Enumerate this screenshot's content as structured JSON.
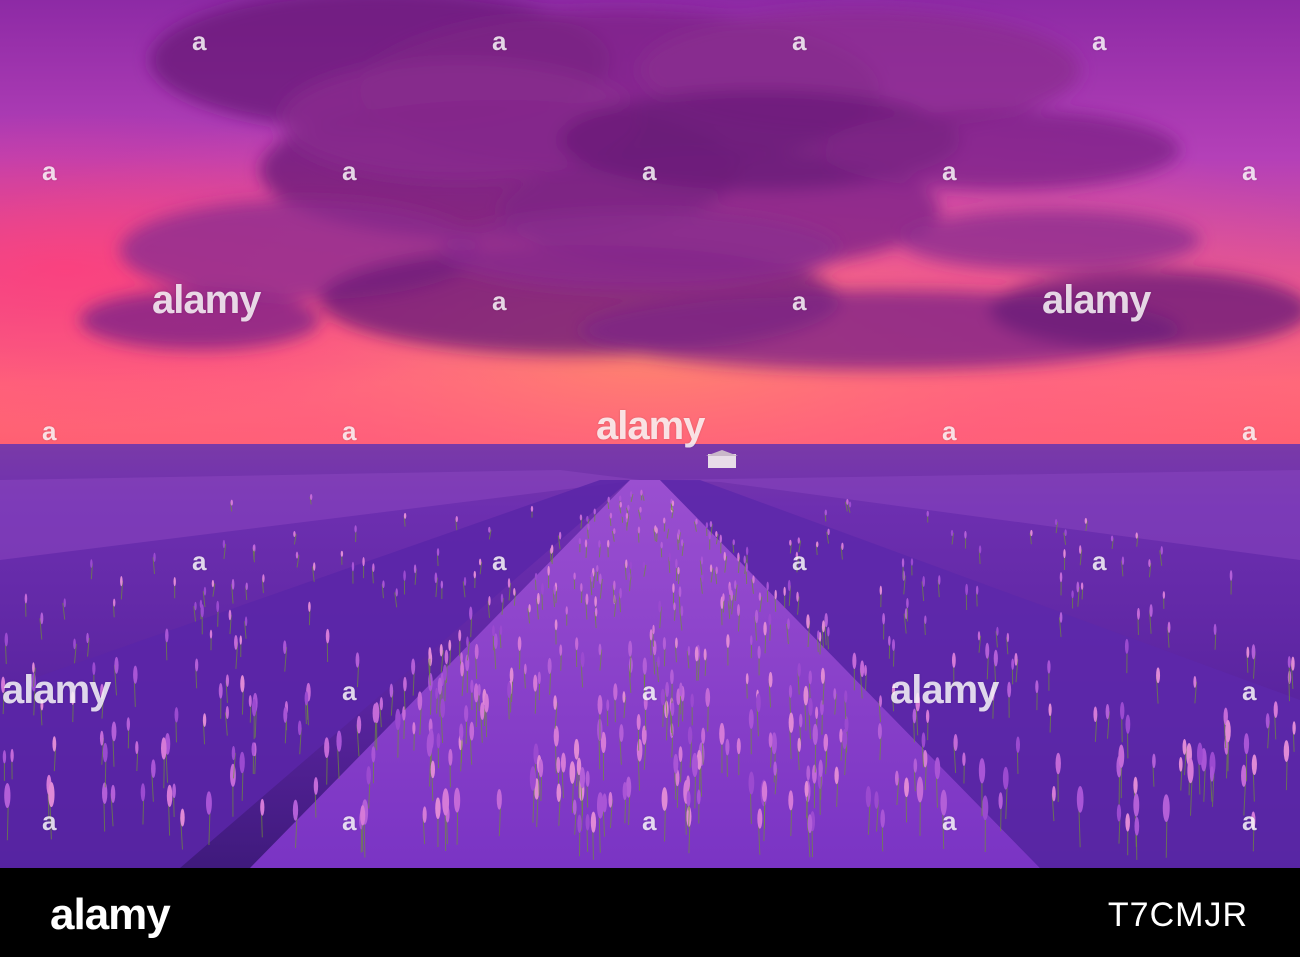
{
  "watermark": {
    "text": "alamy",
    "mark": "a"
  },
  "footer": {
    "logo": "alamy",
    "image_id": "T7CMJR"
  },
  "colors": {
    "sky_top": "#9a2fa8",
    "sky_glow": "#ff6b8a",
    "horizon": "#ff5f7a",
    "cloud": "#6e1f78",
    "lavender_dark": "#4a1d8e",
    "lavender_bright": "#b45fe0",
    "stem_green": "#7c9a3a",
    "footer_bg": "#000000"
  }
}
